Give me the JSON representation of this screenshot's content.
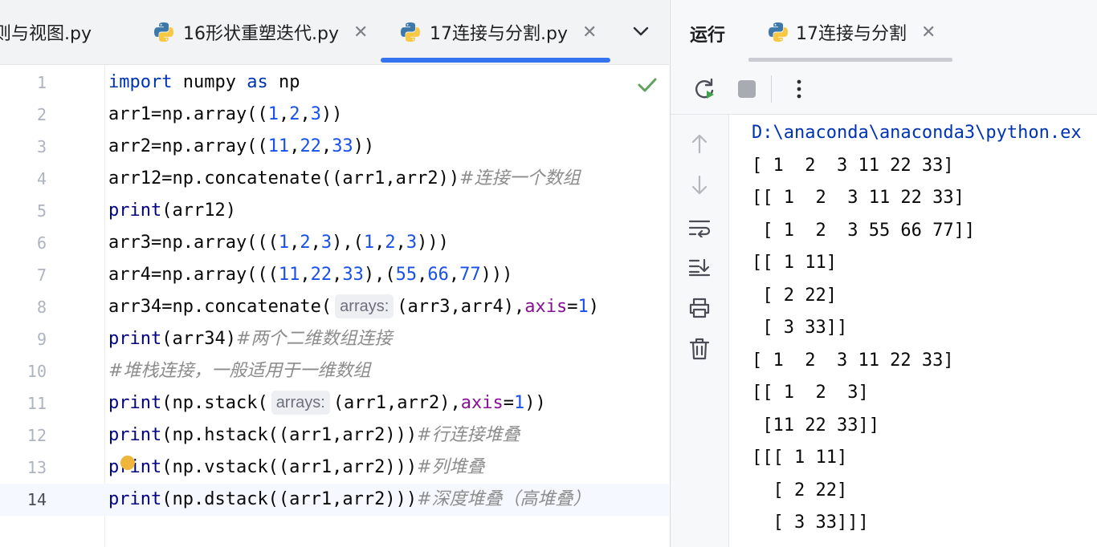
{
  "editor_tabs": [
    {
      "label": "则与视图.py",
      "active": false
    },
    {
      "label": "16形状重塑迭代.py",
      "active": false
    },
    {
      "label": "17连接与分割.py",
      "active": true
    }
  ],
  "editor": {
    "line_numbers": [
      "1",
      "2",
      "3",
      "4",
      "5",
      "6",
      "7",
      "8",
      "9",
      "10",
      "11",
      "12",
      "13",
      "14"
    ],
    "current_line": 14,
    "inlay_hint_label": "arrays:"
  },
  "code_fragments": {
    "l1_kw1": "import",
    "l1_mid": " numpy ",
    "l1_kw2": "as",
    "l1_end": " np",
    "l2_a": "arr1=np.array((",
    "l2_n1": "1",
    "l2_n2": "2",
    "l2_n3": "3",
    "l2_b": "))",
    "l3_a": "arr2=np.array((",
    "l3_n1": "11",
    "l3_n2": "22",
    "l3_n3": "33",
    "l3_b": "))",
    "l4_a": "arr12=np.concatenate((arr1,arr2))",
    "l4_c": "#连接一个数组",
    "l5_fn": "print",
    "l5_a": "(arr12)",
    "l6_a": "arr3=np.array(((",
    "l6_n1": "1",
    "l6_n2": "2",
    "l6_n3": "3",
    "l6_b": "),(",
    "l6_n4": "1",
    "l6_n5": "2",
    "l6_n6": "3",
    "l6_c": ")))",
    "l7_a": "arr4=np.array(((",
    "l7_n1": "11",
    "l7_n2": "22",
    "l7_n3": "33",
    "l7_b": "),(",
    "l7_n4": "55",
    "l7_n5": "66",
    "l7_n6": "77",
    "l7_c": ")))",
    "l8_a": "arr34=np.concatenate(",
    "l8_b": "(arr3,arr4),",
    "l8_p": "axis",
    "l8_eq": "=",
    "l8_n": "1",
    "l8_c": ")",
    "l9_fn": "print",
    "l9_a": "(arr34)",
    "l9_c": "#两个二维数组连接",
    "l10_c": "#堆栈连接，一般适用于一维数组",
    "l11_fn": "print",
    "l11_a": "(np.stack(",
    "l11_b": "(arr1,arr2),",
    "l11_p": "axis",
    "l11_eq": "=",
    "l11_n": "1",
    "l11_c": "))",
    "l12_fn": "print",
    "l12_a": "(np.hstack((arr1,arr2)))",
    "l12_c": "#行连接堆叠",
    "l13_fn": "print",
    "l13_a": "(np.vstack((arr1,arr2)))",
    "l13_c": "#列堆叠",
    "l14_fn": "print",
    "l14_a": "(np.dstack((arr1,arr2)))",
    "l14_c": "#深度堆叠（高堆叠）"
  },
  "run_panel": {
    "title": "运行",
    "tab_label": "17连接与分割",
    "output": [
      "D:\\anaconda\\anaconda3\\python.ex",
      "[ 1  2  3 11 22 33]",
      "[[ 1  2  3 11 22 33]",
      " [ 1  2  3 55 66 77]]",
      "[[ 1 11]",
      " [ 2 22]",
      " [ 3 33]]",
      "[ 1  2  3 11 22 33]",
      "[[ 1  2  3]",
      " [11 22 33]]",
      "[[[ 1 11]",
      "  [ 2 22]",
      "  [ 3 33]]]"
    ]
  },
  "colors": {
    "accent": "#3574f0",
    "keyword": "#0033b3",
    "number": "#1750eb",
    "comment": "#8c8c8c",
    "param": "#871094",
    "ok_check": "#5fa35f"
  }
}
